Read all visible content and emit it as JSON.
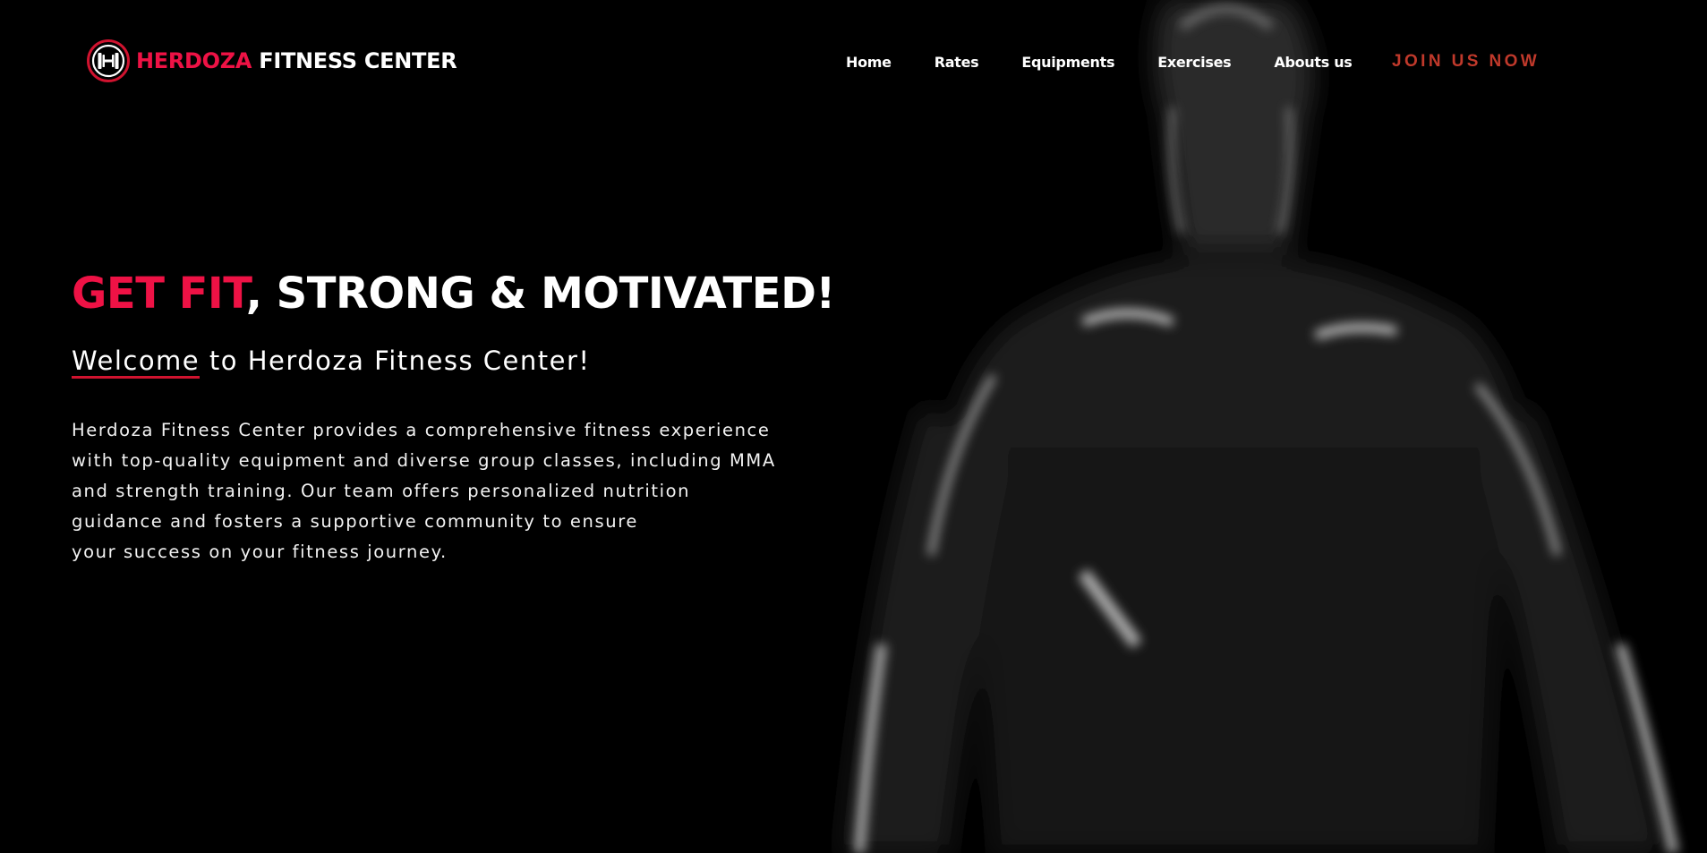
{
  "brand": {
    "name_accent": "HERDOZA",
    "name_rest": " FITNESS CENTER",
    "logo_letter": "H",
    "colors": {
      "accent": "#ee1245",
      "cta": "#c0392b",
      "background": "#000000",
      "text": "#ffffff"
    }
  },
  "nav": {
    "items": [
      {
        "label": "Home"
      },
      {
        "label": "Rates"
      },
      {
        "label": "Equipments"
      },
      {
        "label": "Exercises"
      },
      {
        "label": "Abouts us"
      }
    ],
    "cta_label": "JOIN US NOW"
  },
  "hero": {
    "title_accent": "GET FIT",
    "title_rest": ", STRONG & MOTIVATED!",
    "subtitle_underlined": "Welcome",
    "subtitle_rest": " to Herdoza Fitness Center!",
    "body_lines": [
      "Herdoza Fitness Center provides a comprehensive fitness experience",
      "with top-quality equipment and diverse group classes, including MMA",
      "and strength training. Our team offers personalized nutrition",
      "guidance and fosters a supportive community to ensure",
      "your success on your fitness journey."
    ]
  },
  "icons": {
    "logo": "dumbbell-h-logo-icon"
  }
}
